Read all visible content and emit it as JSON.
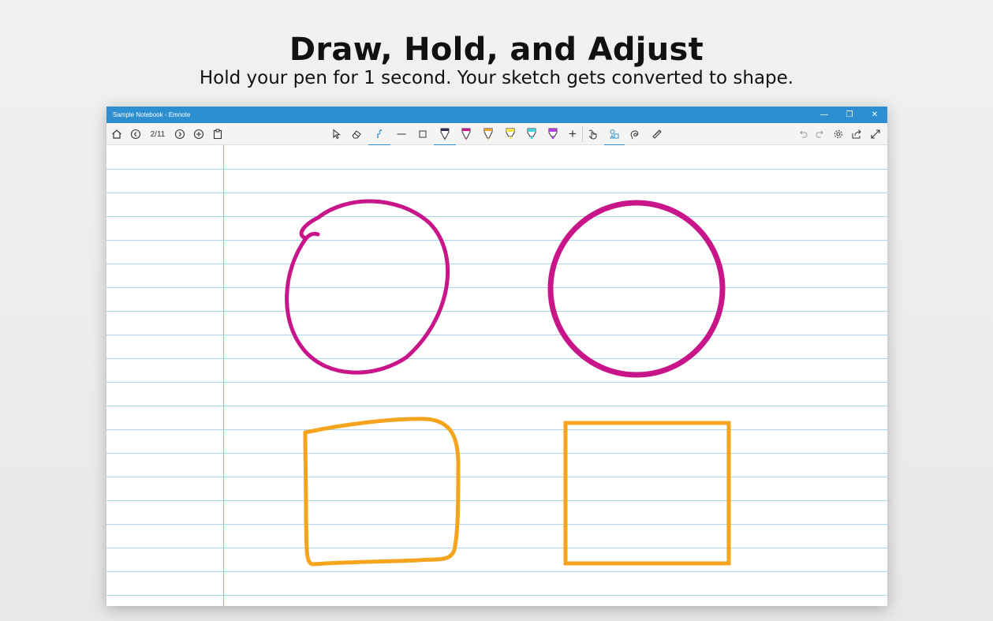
{
  "hero": {
    "title": "Draw, Hold, and Adjust",
    "subtitle": "Hold your pen for 1 second. Your sketch gets converted to shape."
  },
  "window": {
    "title": "Sample Notebook - Emnote",
    "controls": {
      "minimize": "—",
      "restore": "❐",
      "close": "✕"
    }
  },
  "toolbar": {
    "page_indicator": "2/11",
    "pen_colors": [
      "#2b2b55",
      "#c8168a",
      "#f3a32b",
      "#f2e24a",
      "#3fd0d8",
      "#b43fd6"
    ],
    "add_label": "+"
  },
  "colors": {
    "accent": "#2d8fcf",
    "sketch_circle": "#c8168a",
    "sketch_rect": "#f5a41d",
    "rule_line": "#a9d6ee",
    "margin": "#f09a9a"
  }
}
